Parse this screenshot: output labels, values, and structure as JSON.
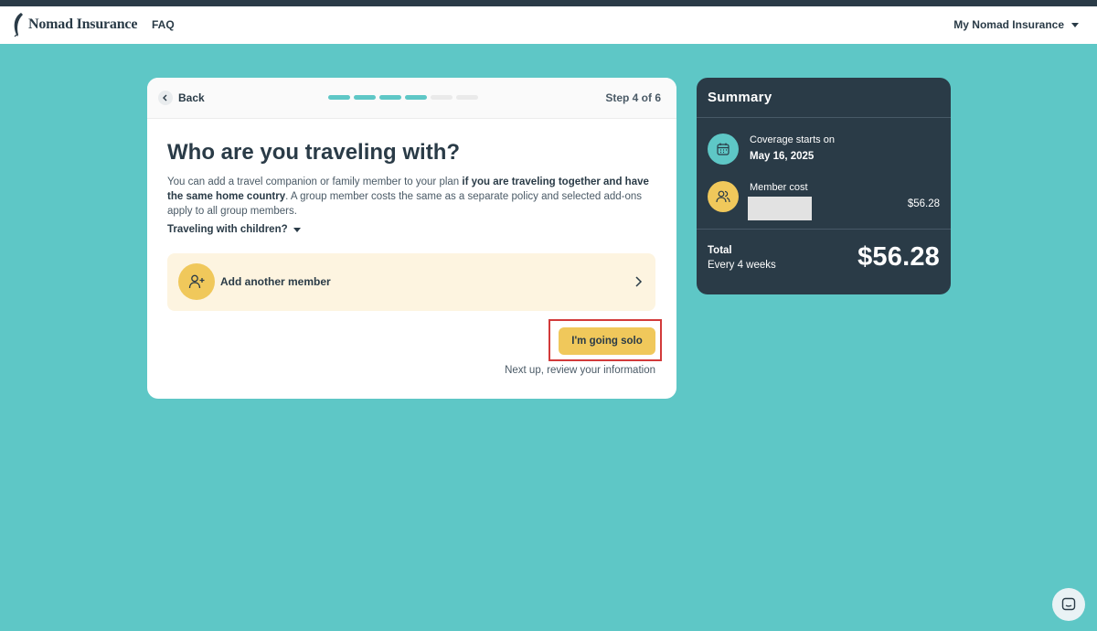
{
  "header": {
    "brand": "Nomad Insurance",
    "faq_label": "FAQ",
    "account_label": "My Nomad Insurance"
  },
  "step_card": {
    "back_label": "Back",
    "step_label": "Step 4 of 6",
    "progress": {
      "total_steps": 6,
      "completed_steps": 4
    },
    "title": "Who are you traveling with?",
    "description_part1": "You can add a travel companion or family member to your plan ",
    "description_bold": "if you are traveling together and have the same home country",
    "description_part2": ". A group member costs the same as a separate policy and selected add-ons apply to all group members.",
    "children_toggle_label": "Traveling with children?",
    "add_member_label": "Add another member",
    "solo_button_label": "I'm going solo",
    "next_up_text": "Next up, review your information"
  },
  "summary": {
    "title": "Summary",
    "coverage_label": "Coverage starts on",
    "coverage_date": "May 16, 2025",
    "member_cost_label": "Member cost",
    "member_cost_value": "$56.28",
    "total_label": "Total",
    "total_period": "Every 4 weeks",
    "total_amount": "$56.28"
  },
  "colors": {
    "background": "#5ec7c6",
    "navy": "#2a3b47",
    "accent_yellow": "#f0c85b",
    "highlight_red": "#d23a3a"
  },
  "icons": {
    "logo": "feather-icon",
    "back": "chevron-left-icon",
    "add_member": "user-plus-icon",
    "add_member_chevron": "chevron-right-icon",
    "coverage": "calendar-icon",
    "member_cost": "users-icon",
    "chat": "chat-icon"
  }
}
